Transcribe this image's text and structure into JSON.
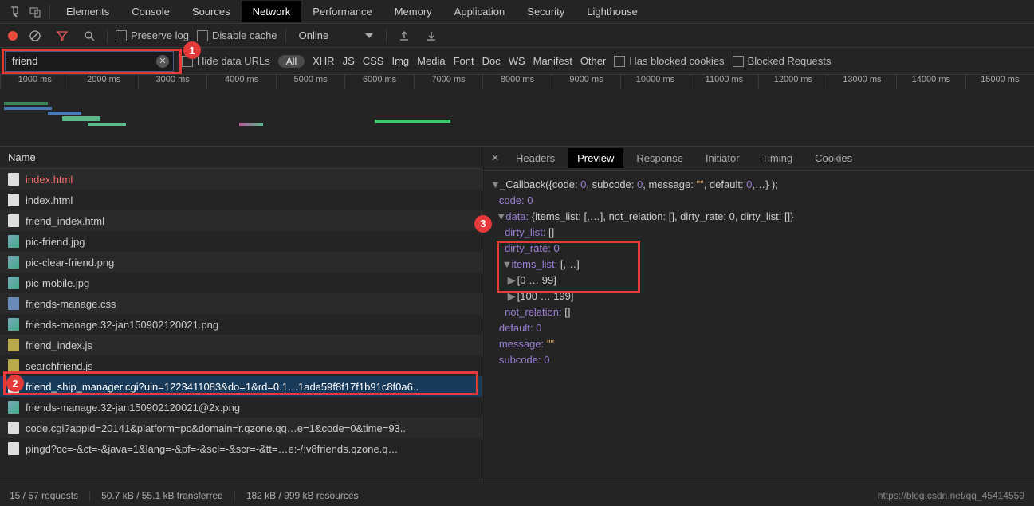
{
  "tabs": [
    "Elements",
    "Console",
    "Sources",
    "Network",
    "Performance",
    "Memory",
    "Application",
    "Security",
    "Lighthouse"
  ],
  "active_tab": "Network",
  "toolbar": {
    "preserve_log": "Preserve log",
    "disable_cache": "Disable cache",
    "throttling": "Online"
  },
  "filter": {
    "value": "friend",
    "hide_data_urls": "Hide data URLs",
    "types": [
      "All",
      "XHR",
      "JS",
      "CSS",
      "Img",
      "Media",
      "Font",
      "Doc",
      "WS",
      "Manifest",
      "Other"
    ],
    "has_blocked_cookies": "Has blocked cookies",
    "blocked_requests": "Blocked Requests"
  },
  "timeline_ticks": [
    "1000 ms",
    "2000 ms",
    "3000 ms",
    "4000 ms",
    "5000 ms",
    "6000 ms",
    "7000 ms",
    "8000 ms",
    "9000 ms",
    "10000 ms",
    "11000 ms",
    "12000 ms",
    "13000 ms",
    "14000 ms",
    "15000 ms"
  ],
  "name_header": "Name",
  "requests": [
    {
      "name": "index.html",
      "icon": "doc",
      "cls": "red"
    },
    {
      "name": "index.html",
      "icon": "doc",
      "cls": ""
    },
    {
      "name": "friend_index.html",
      "icon": "doc",
      "cls": ""
    },
    {
      "name": "pic-friend.jpg",
      "icon": "img",
      "cls": ""
    },
    {
      "name": "pic-clear-friend.png",
      "icon": "img",
      "cls": ""
    },
    {
      "name": "pic-mobile.jpg",
      "icon": "img",
      "cls": ""
    },
    {
      "name": "friends-manage.css",
      "icon": "css",
      "cls": ""
    },
    {
      "name": "friends-manage.32-jan150902120021.png",
      "icon": "img",
      "cls": ""
    },
    {
      "name": "friend_index.js",
      "icon": "js",
      "cls": ""
    },
    {
      "name": "searchfriend.js",
      "icon": "js",
      "cls": ""
    },
    {
      "name": "friend_ship_manager.cgi?uin=1223411083&do=1&rd=0.1…1ada59f8f17f1b91c8f0a6..",
      "icon": "doc",
      "cls": "selected"
    },
    {
      "name": "friends-manage.32-jan150902120021@2x.png",
      "icon": "img",
      "cls": ""
    },
    {
      "name": "code.cgi?appid=20141&platform=pc&domain=r.qzone.qq…e=1&code=0&time=93..",
      "icon": "doc",
      "cls": ""
    },
    {
      "name": "pingd?cc=-&ct=-&java=1&lang=-&pf=-&scl=-&scr=-&tt=…e:-/;v8friends.qzone.q…",
      "icon": "doc",
      "cls": ""
    }
  ],
  "detail_tabs": [
    "Headers",
    "Preview",
    "Response",
    "Initiator",
    "Timing",
    "Cookies"
  ],
  "active_detail_tab": "Preview",
  "preview": {
    "line0": "▼ _Callback({code: 0, subcode: 0, message: \"\", default: 0,…} );",
    "code_kv": "code: ",
    "code_val": "0",
    "data_line": "data: {items_list: [,…], not_relation: [], dirty_rate: 0, dirty_list: []}",
    "dirty_list": "dirty_list: []",
    "dirty_rate_k": "dirty_rate: ",
    "dirty_rate_v": "0",
    "items_list": "items_list: [,…]",
    "range1": "[0 … 99]",
    "range2": "[100 … 199]",
    "not_relation": "not_relation: []",
    "default_k": "default: ",
    "default_v": "0",
    "message_k": "message: ",
    "message_v": "\"\"",
    "subcode_k": "subcode: ",
    "subcode_v": "0"
  },
  "status": {
    "requests": "15 / 57 requests",
    "transferred": "50.7 kB / 55.1 kB transferred",
    "resources": "182 kB / 999 kB resources",
    "watermark": "https://blog.csdn.net/qq_45414559"
  },
  "callouts": {
    "c1": "1",
    "c2": "2",
    "c3": "3"
  }
}
